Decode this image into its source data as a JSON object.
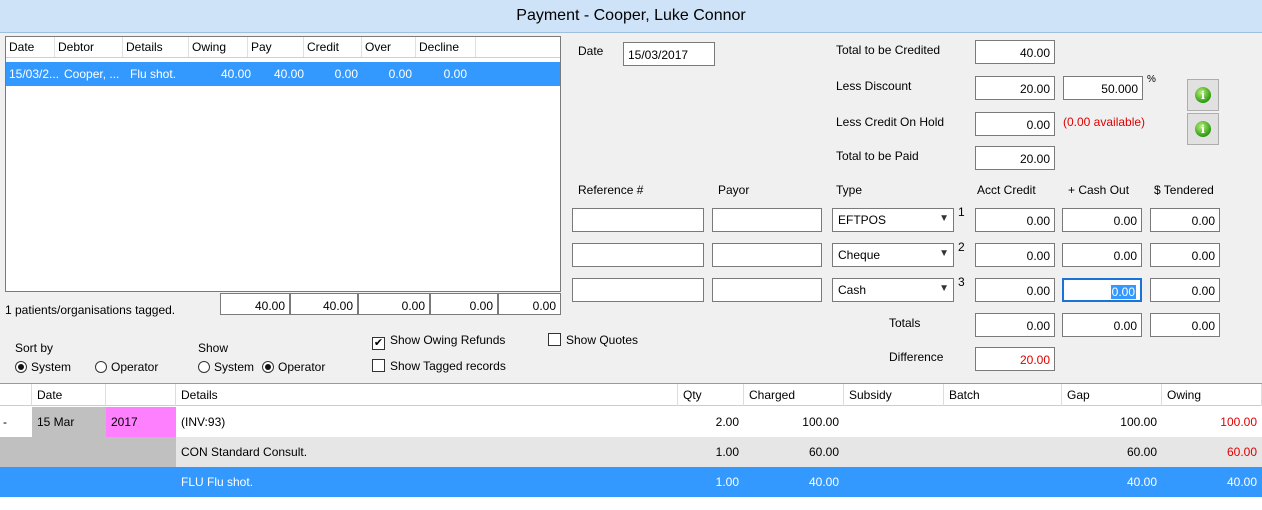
{
  "window": {
    "title": "Payment - Cooper, Luke Connor"
  },
  "debtor_list": {
    "columns": [
      "Date",
      "Debtor",
      "Details",
      "Owing",
      "Pay",
      "Credit",
      "Over",
      "Decline"
    ],
    "rows": [
      {
        "date": "15/03/2...",
        "debtor": "Cooper, ...",
        "details": "Flu shot.",
        "owing": "40.00",
        "pay": "40.00",
        "credit": "0.00",
        "over": "0.00",
        "decline": "0.00"
      }
    ],
    "tagged_text": "1 patients/organisations tagged.",
    "totals": {
      "owing": "40.00",
      "pay": "40.00",
      "credit": "0.00",
      "over": "0.00",
      "decline": "0.00"
    }
  },
  "options": {
    "sort_by_label": "Sort by",
    "sort_options": [
      "System",
      "Operator"
    ],
    "sort_selected": "System",
    "show_label": "Show",
    "show_options": [
      "System",
      "Operator"
    ],
    "show_selected": "Operator",
    "show_owing_refunds_label": "Show Owing Refunds",
    "show_owing_refunds_checked": true,
    "show_tagged_records_label": "Show Tagged records",
    "show_tagged_records_checked": false,
    "show_quotes_label": "Show Quotes",
    "show_quotes_checked": false
  },
  "payment": {
    "date_label": "Date",
    "date_value": "15/03/2017",
    "total_credited_label": "Total to be Credited",
    "total_credited_value": "40.00",
    "less_discount_label": "Less Discount",
    "less_discount_value": "20.00",
    "discount_percent_value": "50.000",
    "percent_symbol": "%",
    "less_credit_on_hold_label": "Less Credit On Hold",
    "less_credit_on_hold_value": "0.00",
    "credit_available_text": "(0.00 available)",
    "total_paid_label": "Total to be Paid",
    "total_paid_value": "20.00",
    "columns": {
      "reference": "Reference #",
      "payor": "Payor",
      "type": "Type",
      "acct_credit": "Acct Credit",
      "cash_out": "+ Cash Out",
      "tendered": "$ Tendered"
    },
    "lines": [
      {
        "type": "EFTPOS",
        "num": "1",
        "acct_credit": "0.00",
        "cash_out": "0.00",
        "tendered": "0.00"
      },
      {
        "type": "Cheque",
        "num": "2",
        "acct_credit": "0.00",
        "cash_out": "0.00",
        "tendered": "0.00"
      },
      {
        "type": "Cash",
        "num": "3",
        "acct_credit": "0.00",
        "cash_out": "0.00",
        "tendered": "0.00"
      }
    ],
    "totals_label": "Totals",
    "totals": {
      "acct_credit": "0.00",
      "cash_out": "0.00",
      "tendered": "0.00"
    },
    "difference_label": "Difference",
    "difference_value": "20.00"
  },
  "invoice_grid": {
    "columns": [
      "Date",
      "",
      "Details",
      "Qty",
      "Charged",
      "Subsidy",
      "Batch",
      "Gap",
      "Owing"
    ],
    "rows": [
      {
        "expander": "-",
        "day": "15 Mar",
        "year": "2017",
        "details": "(INV:93)",
        "qty": "2.00",
        "charged": "100.00",
        "subsidy": "",
        "batch": "",
        "gap": "100.00",
        "owing": "100.00"
      },
      {
        "expander": "",
        "day": "",
        "year": "",
        "details": "CON Standard Consult.",
        "qty": "1.00",
        "charged": "60.00",
        "subsidy": "",
        "batch": "",
        "gap": "60.00",
        "owing": "60.00"
      },
      {
        "expander": "",
        "day": "",
        "year": "",
        "details": "FLU Flu shot.",
        "qty": "1.00",
        "charged": "40.00",
        "subsidy": "",
        "batch": "",
        "gap": "40.00",
        "owing": "40.00"
      }
    ]
  },
  "colors": {
    "selection": "#3399ff",
    "negative_red": "#e00000",
    "year_highlight": "#ff80ff",
    "group_gray": "#c0c0c0",
    "subrow_gray": "#e6e6e6"
  }
}
